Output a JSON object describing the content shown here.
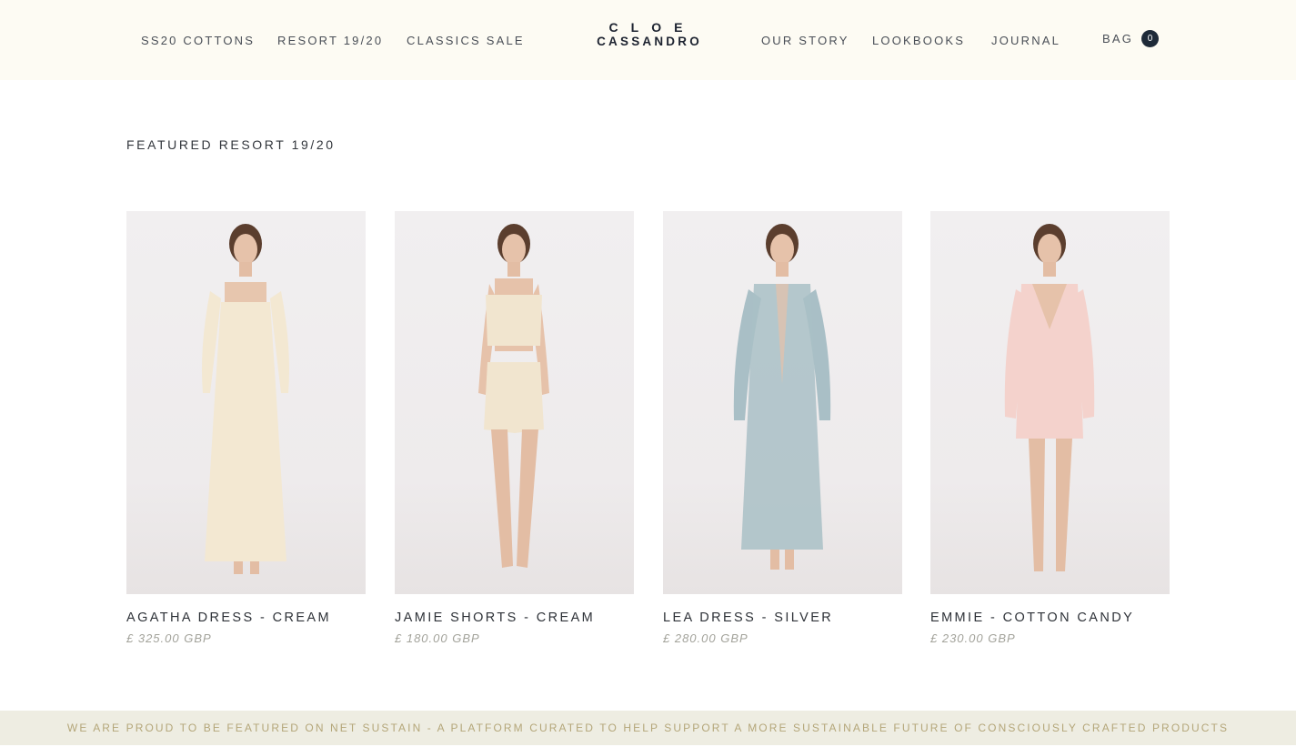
{
  "header": {
    "nav_left": [
      "SS20 COTTONS",
      "RESORT 19/20",
      "CLASSICS SALE"
    ],
    "logo": {
      "line1": "CLOE",
      "line2": "CASSANDRO"
    },
    "nav_right": [
      "OUR STORY",
      "LOOKBOOKS",
      "JOURNAL"
    ],
    "bag": {
      "label": "BAG",
      "count": "0"
    }
  },
  "section": {
    "title": "FEATURED RESORT 19/20"
  },
  "products": [
    {
      "name": "AGATHA DRESS - CREAM",
      "price": "£ 325.00 GBP",
      "garment_color": "#f3e8d2"
    },
    {
      "name": "JAMIE SHORTS - CREAM",
      "price": "£ 180.00 GBP",
      "garment_color": "#f1e5cf"
    },
    {
      "name": "LEA DRESS - SILVER",
      "price": "£ 280.00 GBP",
      "garment_color": "#a9bfc6"
    },
    {
      "name": "EMMIE - COTTON CANDY",
      "price": "£ 230.00 GBP",
      "garment_color": "#f4d2cc"
    }
  ],
  "banner": {
    "text": "WE ARE PROUD TO BE FEATURED ON NET SUSTAIN - A PLATFORM CURATED TO HELP SUPPORT A MORE SUSTAINABLE FUTURE OF CONSCIOUSLY CRAFTED PRODUCTS"
  },
  "colors": {
    "header_bg": "#fdfbf3",
    "banner_bg": "#eeede2",
    "banner_text": "#b4a679",
    "bag_badge": "#1e2a38"
  }
}
